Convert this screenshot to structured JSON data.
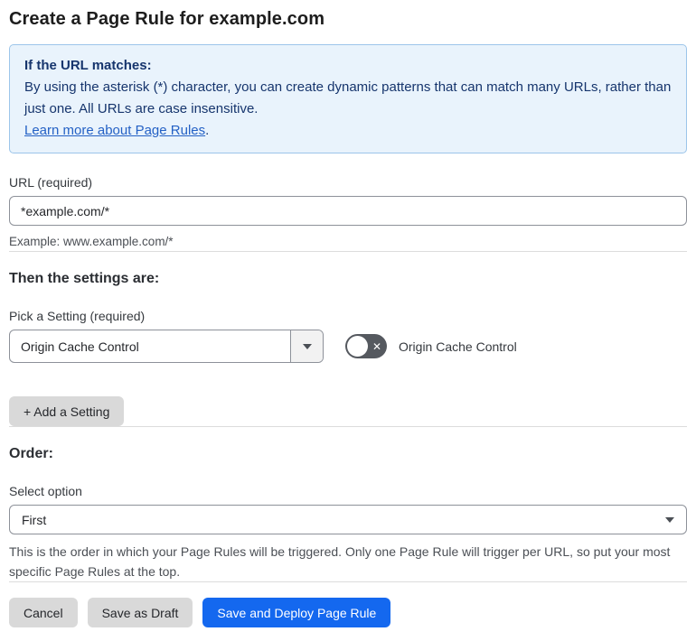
{
  "page": {
    "title": "Create a Page Rule for example.com"
  },
  "info_box": {
    "heading": "If the URL matches:",
    "body": "By using the asterisk (*) character, you can create dynamic patterns that can match many URLs, rather than just one. All URLs are case insensitive.",
    "link_label": "Learn more about Page Rules",
    "link_suffix": "."
  },
  "url_section": {
    "label": "URL (required)",
    "input_value": "*example.com/*",
    "helper": "Example: www.example.com/*"
  },
  "settings_section": {
    "heading": "Then the settings are:",
    "pick_label": "Pick a Setting (required)",
    "selected_setting": "Origin Cache Control",
    "toggle_label": "Origin Cache Control",
    "toggle_state": "off",
    "toggle_glyph": "✕",
    "add_button_label": "+ Add a Setting"
  },
  "order_section": {
    "heading": "Order:",
    "label": "Select option",
    "selected_option": "First",
    "helper": "This is the order in which your Page Rules will be triggered. Only one Page Rule will trigger per URL, so put your most specific Page Rules at the top."
  },
  "footer": {
    "cancel_label": "Cancel",
    "save_draft_label": "Save as Draft",
    "save_deploy_label": "Save and Deploy Page Rule"
  },
  "colors": {
    "info_box_bg": "#e9f3fc",
    "info_box_border": "#9cc5ea",
    "info_box_text": "#16356d",
    "link_blue": "#2461c5",
    "primary_button_blue": "#1468ef",
    "gray_button_bg": "#d9d9d9",
    "toggle_off_bg": "#55595f"
  }
}
